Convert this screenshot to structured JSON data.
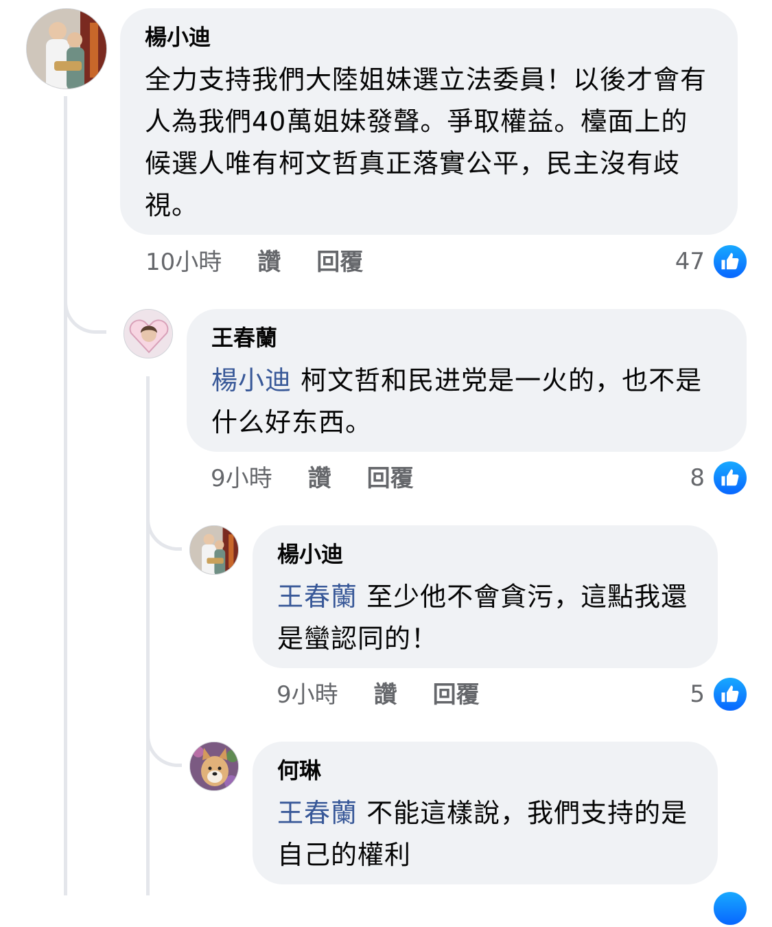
{
  "comments": [
    {
      "author": "楊小迪",
      "text": "全力支持我們大陸姐妹選立法委員！以後才會有人為我們40萬姐妹發聲。爭取權益。檯面上的候選人唯有柯文哲真正落實公平，民主沒有歧視。",
      "time": "10小時",
      "like_label": "讚",
      "reply_label": "回覆",
      "likes": "47"
    }
  ],
  "replies": [
    {
      "author": "王春蘭",
      "mention": "楊小迪",
      "text": "柯文哲和民进党是一火的，也不是什么好东西。",
      "time": "9小時",
      "like_label": "讚",
      "reply_label": "回覆",
      "likes": "8"
    },
    {
      "author": "楊小迪",
      "mention": "王春蘭",
      "text": "至少他不會貪污，這點我還是蠻認同的！",
      "time": "9小時",
      "like_label": "讚",
      "reply_label": "回覆",
      "likes": "5"
    },
    {
      "author": "何琳",
      "mention": "王春蘭",
      "text": "不能這樣說，我們支持的是自己的權利"
    }
  ],
  "colors": {
    "bubble": "#f0f2f5",
    "mention": "#385898",
    "like_badge": "#0866ff",
    "meta": "#65676b"
  }
}
